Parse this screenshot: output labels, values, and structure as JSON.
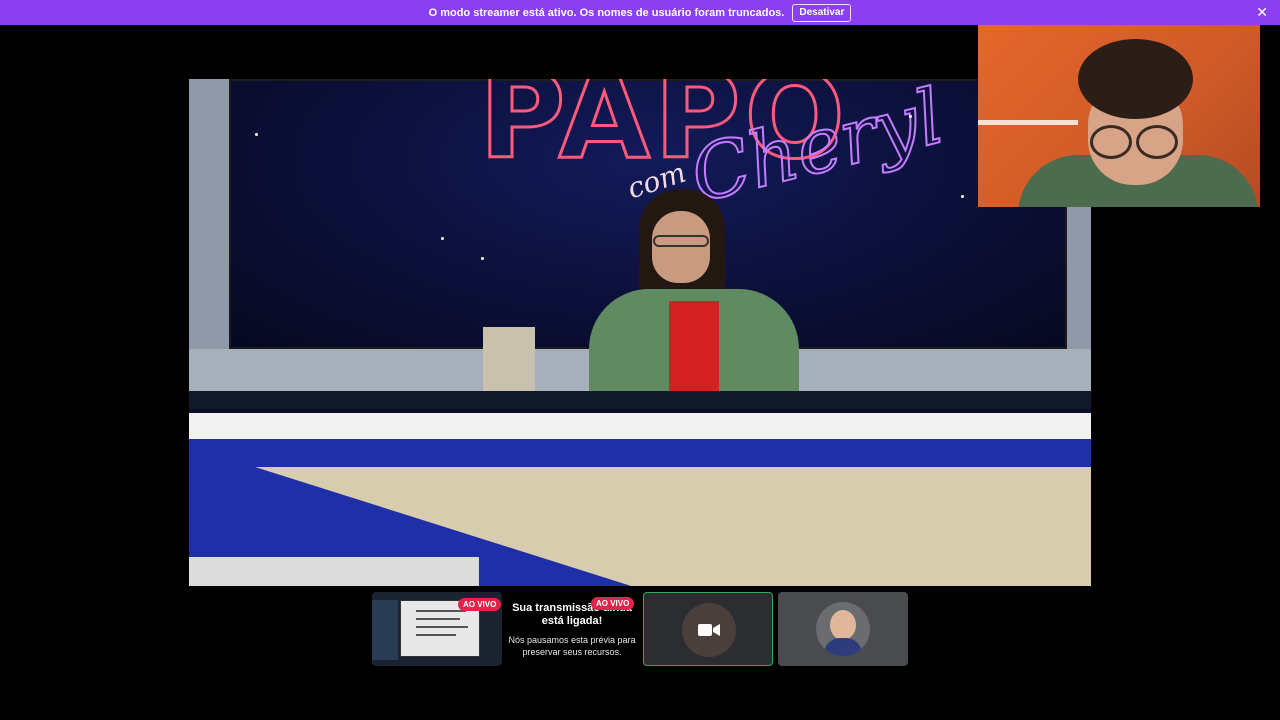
{
  "banner": {
    "message": "O modo streamer está ativo. Os nomes de usuário foram truncados.",
    "disable_label": "Desativar",
    "close_icon": "close-icon",
    "color": "#8a3ff0"
  },
  "stream": {
    "live_badge": "AO VIVO",
    "preview_paused_title": "Sua transmissão ainda está ligada!",
    "preview_paused_body": "Nós pausamos esta prévia para preservar seus recursos.",
    "live_color": "#e0244b"
  },
  "participants": {
    "camera_icon": "camera-icon",
    "active_speaker_color": "#3ba55d"
  }
}
